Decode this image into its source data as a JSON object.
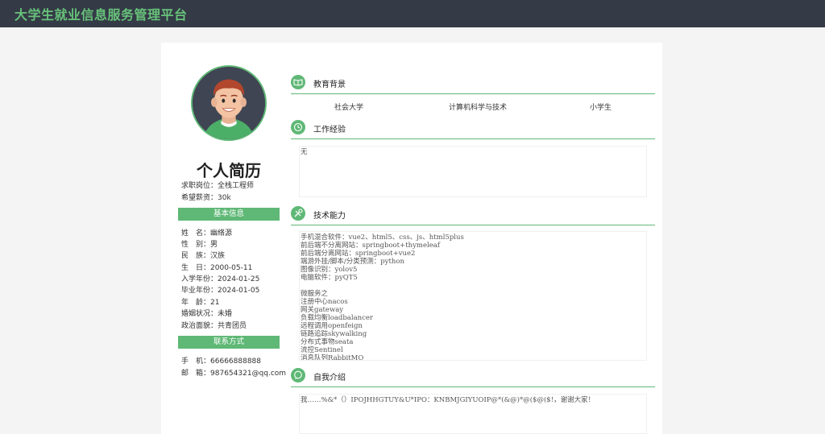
{
  "app": {
    "title": "大学生就业信息服务管理平台"
  },
  "profile": {
    "title": "个人简历",
    "job_label": "求职岗位：",
    "job_value": "全栈工程师",
    "salary_label": "希望薪资：",
    "salary_value": "30k"
  },
  "basic": {
    "heading": "基本信息",
    "fields": [
      {
        "label": "姓　名：",
        "value": "幽络源"
      },
      {
        "label": "性　别：",
        "value": "男"
      },
      {
        "label": "民　族：",
        "value": "汉族"
      },
      {
        "label": "生　日：",
        "value": "2000-05-11"
      },
      {
        "label": "入学年份：",
        "value": "2024-01-25"
      },
      {
        "label": "毕业年份：",
        "value": "2024-01-05"
      },
      {
        "label": "年　龄：",
        "value": "21"
      },
      {
        "label": "婚姻状况：",
        "value": "未婚"
      },
      {
        "label": "政治面貌：",
        "value": "共青团员"
      }
    ]
  },
  "contact": {
    "heading": "联系方式",
    "fields": [
      {
        "label": "手　机：",
        "value": "66666888888"
      },
      {
        "label": "邮　箱：",
        "value": "987654321@qq.com"
      }
    ]
  },
  "sections": {
    "education": {
      "heading": "教育背景",
      "school": "社会大学",
      "major": "计算机科学与技术",
      "degree": "小学生",
      "icon": "book-icon"
    },
    "work": {
      "heading": "工作经验",
      "content": "无",
      "icon": "clock-icon"
    },
    "skills": {
      "heading": "技术能力",
      "icon": "tools-icon",
      "content": "手机混合软件：vue2、html5、css、js、html5plus\n前后端不分离网站：springboot+thymeleaf\n前后端分离网站：springboot+vue2\n端游外挂/脚本/分类预测：python\n图像识别：yolov5\n电脑软件：pyQT5\n\n微服务之\n注册中心nacos\n网关gateway\n负载均衡loadbalancer\n远程调用openfeign\n链路追踪skywalking\n分布式事物seata\n流控Sentinel\n消息队列RabbitMQ"
    },
    "intro": {
      "heading": "自我介绍",
      "content": "我……%&*（）IPOJHHGTUY&U*IPO：KNBMJGIYUOIP@*(&@)*@($@($!，谢谢大家！",
      "icon": "chat-icon"
    }
  },
  "colors": {
    "accent": "#5fb876",
    "topbar": "#343a46",
    "title": "#67c27a"
  }
}
